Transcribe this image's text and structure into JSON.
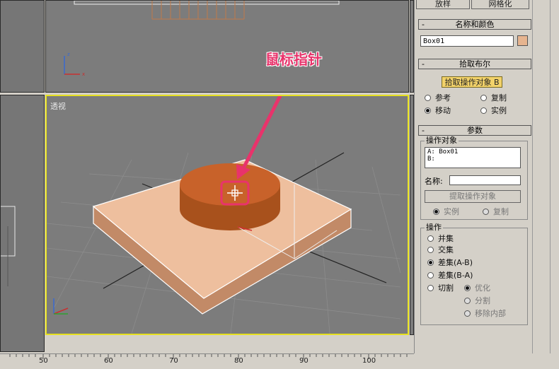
{
  "top_buttons": {
    "left": "放样",
    "right": "网格化"
  },
  "viewport_perspective": {
    "label": "透视"
  },
  "annotation": {
    "text": "鼠标指针"
  },
  "name_color": {
    "title": "名称和颜色",
    "object_name": "Box01",
    "swatch_color": "#e6b48f"
  },
  "pick_boolean": {
    "title": "拾取布尔",
    "pick_button": "拾取操作对象 B",
    "options": {
      "reference": "参考",
      "copy": "复制",
      "move": "移动",
      "instance": "实例"
    }
  },
  "params": {
    "title": "参数",
    "operands_label": "操作对象",
    "operand_a": "A: Box01",
    "operand_b": "B:",
    "name_label": "名称:",
    "name_value": "",
    "extract_button": "提取操作对象",
    "extract_instance": "实例",
    "extract_copy": "复制",
    "operation_label": "操作",
    "ops": {
      "union": "并集",
      "intersection": "交集",
      "subtract_ab": "差集(A-B)",
      "subtract_ba": "差集(B-A)",
      "cut": "切割",
      "refine": "优化",
      "split": "分割",
      "remove_inside": "移除内部"
    }
  },
  "ruler": {
    "ticks": [
      "50",
      "60",
      "70",
      "80",
      "90",
      "100"
    ]
  },
  "colors": {
    "accent_annotation": "#e8336b",
    "active_viewport_border": "#e6e020"
  }
}
